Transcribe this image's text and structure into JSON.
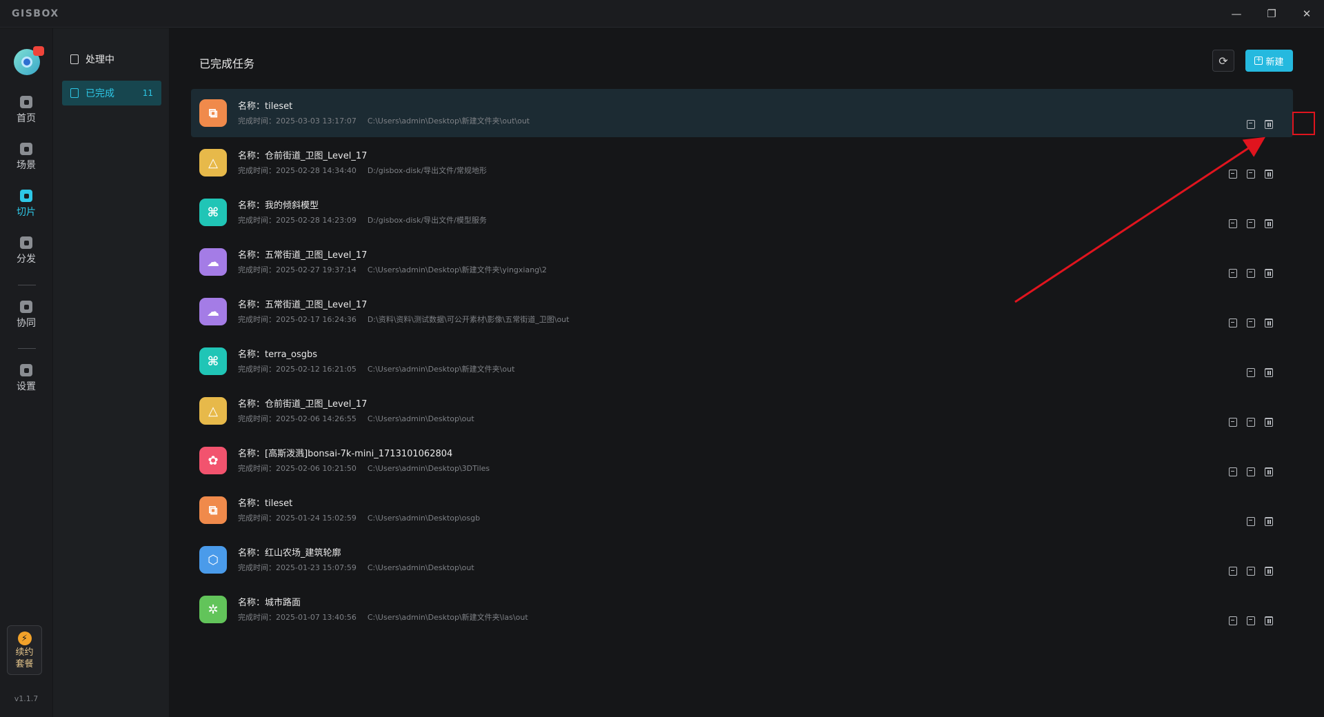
{
  "app": {
    "logo": "GISBOX"
  },
  "window": {
    "minimize": "—",
    "restore": "❐",
    "close": "✕"
  },
  "rail": {
    "items": [
      {
        "label": "首页",
        "icon": "home-icon"
      },
      {
        "label": "场景",
        "icon": "cube-icon"
      },
      {
        "label": "切片",
        "icon": "slice-icon",
        "active": true
      },
      {
        "label": "分发",
        "icon": "distribute-icon"
      },
      {
        "label": "协同",
        "icon": "lock-icon"
      },
      {
        "label": "设置",
        "icon": "gear-icon"
      }
    ],
    "renew_label": "续约\n套餐",
    "renew_icon": "⚡",
    "version": "v1.1.7"
  },
  "subside": {
    "items": [
      {
        "label": "处理中",
        "icon": "processing-doc-icon"
      },
      {
        "label": "已完成",
        "icon": "completed-doc-icon",
        "count": "11",
        "active": true
      }
    ]
  },
  "main": {
    "title": "已完成任务",
    "refresh_icon": "⟳",
    "new_label": "新建",
    "name_prefix": "名称：",
    "time_prefix": "完成时间：",
    "tasks": [
      {
        "name": "tileset",
        "time": "2025-03-03 13:17:07",
        "path": "C:\\Users\\admin\\Desktop\\新建文件夹\\out\\out",
        "color": "#f08a4b",
        "glyph": "⧉",
        "deploy": false
      },
      {
        "name": "仓前街道_卫图_Level_17",
        "time": "2025-02-28 14:34:40",
        "path": "D:/gisbox-disk/导出文件/常规地形",
        "color": "#e7b94a",
        "glyph": "△",
        "deploy": true
      },
      {
        "name": "我的倾斜模型",
        "time": "2025-02-28 14:23:09",
        "path": "D:/gisbox-disk/导出文件/模型服务",
        "color": "#20c5b6",
        "glyph": "⌘",
        "deploy": true
      },
      {
        "name": "五常街道_卫图_Level_17",
        "time": "2025-02-27 19:37:14",
        "path": "C:\\Users\\admin\\Desktop\\新建文件夹\\yingxiang\\2",
        "color": "#a47ce6",
        "glyph": "☁",
        "deploy": true
      },
      {
        "name": "五常街道_卫图_Level_17",
        "time": "2025-02-17 16:24:36",
        "path": "D:\\资料\\资料\\测试数据\\可公开素材\\影像\\五常街道_卫图\\out",
        "color": "#a47ce6",
        "glyph": "☁",
        "deploy": true
      },
      {
        "name": "terra_osgbs",
        "time": "2025-02-12 16:21:05",
        "path": "C:\\Users\\admin\\Desktop\\新建文件夹\\out",
        "color": "#20c5b6",
        "glyph": "⌘",
        "deploy": false
      },
      {
        "name": "仓前街道_卫图_Level_17",
        "time": "2025-02-06 14:26:55",
        "path": "C:\\Users\\admin\\Desktop\\out",
        "color": "#e7b94a",
        "glyph": "△",
        "deploy": true
      },
      {
        "name": "[高斯泼溅]bonsai-7k-mini_1713101062804",
        "time": "2025-02-06 10:21:50",
        "path": "C:\\Users\\admin\\Desktop\\3DTiles",
        "color": "#f2536e",
        "glyph": "✿",
        "deploy": true
      },
      {
        "name": "tileset",
        "time": "2025-01-24 15:02:59",
        "path": "C:\\Users\\admin\\Desktop\\osgb",
        "color": "#f08a4b",
        "glyph": "⧉",
        "deploy": false
      },
      {
        "name": "红山农场_建筑轮廓",
        "time": "2025-01-23 15:07:59",
        "path": "C:\\Users\\admin\\Desktop\\out",
        "color": "#4a9bea",
        "glyph": "⬡",
        "deploy": true
      },
      {
        "name": "城市路面",
        "time": "2025-01-07 13:40:56",
        "path": "C:\\Users\\admin\\Desktop\\新建文件夹\\las\\out",
        "color": "#62c45a",
        "glyph": "✲",
        "deploy": true
      }
    ]
  }
}
